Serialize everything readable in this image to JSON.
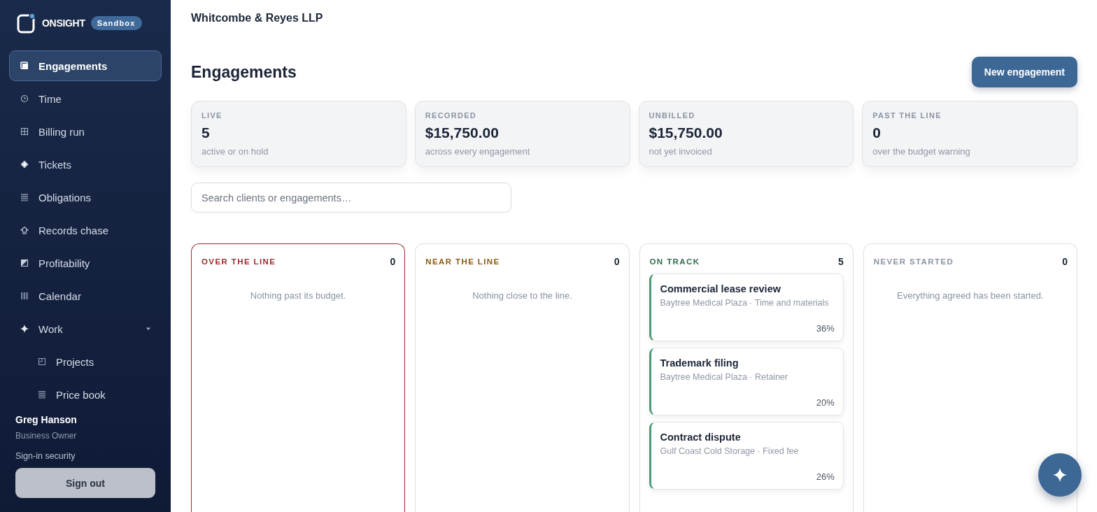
{
  "brand": {
    "name": "ONSIGHT",
    "badge": "Sandbox"
  },
  "nav": [
    {
      "label": "Engagements",
      "selected": true
    },
    {
      "label": "Time",
      "selected": false
    },
    {
      "label": "Billing run",
      "selected": false
    },
    {
      "label": "Tickets",
      "selected": false
    },
    {
      "label": "Obligations",
      "selected": false
    },
    {
      "label": "Records chase",
      "selected": false
    },
    {
      "label": "Profitability",
      "selected": false
    },
    {
      "label": "Calendar",
      "selected": false
    },
    {
      "label": "Work",
      "selected": false,
      "expanded": true,
      "children": [
        {
          "label": "Projects",
          "selected": false
        },
        {
          "label": "Price book",
          "selected": false
        }
      ]
    }
  ],
  "user": {
    "name": "Greg Hanson",
    "role": "Business Owner",
    "security_link": "Sign-in security",
    "sign_out": "Sign out"
  },
  "header": {
    "firm": "Whitcombe & Reyes LLP"
  },
  "page": {
    "title": "Engagements",
    "new_button": "New engagement"
  },
  "stats": [
    {
      "label": "LIVE",
      "value": "5",
      "note": "active or on hold"
    },
    {
      "label": "RECORDED",
      "value": "$15,750.00",
      "note": "across every engagement"
    },
    {
      "label": "UNBILLED",
      "value": "$15,750.00",
      "note": "not yet invoiced"
    },
    {
      "label": "PAST THE LINE",
      "value": "0",
      "note": "over the budget warning"
    }
  ],
  "search": {
    "placeholder": "Search clients or engagements…"
  },
  "columns": [
    {
      "title": "OVER THE LINE",
      "count": "0",
      "color": "#9b2c2c",
      "empty": "Nothing past its budget."
    },
    {
      "title": "NEAR THE LINE",
      "count": "0",
      "color": "#8a5a12",
      "empty": "Nothing close to the line."
    },
    {
      "title": "ON TRACK",
      "count": "5",
      "color": "#2f6b4a",
      "cards": [
        {
          "title": "Commercial lease review",
          "meta": "Baytree Medical Plaza · Time and materials",
          "percent": "36%"
        },
        {
          "title": "Trademark filing",
          "meta": "Baytree Medical Plaza · Retainer",
          "percent": "20%"
        },
        {
          "title": "Contract dispute",
          "meta": "Gulf Coast Cold Storage · Fixed fee",
          "percent": "26%"
        }
      ]
    },
    {
      "title": "NEVER STARTED",
      "count": "0",
      "color": "#8a93a3",
      "empty": "Everything agreed has been started."
    }
  ]
}
